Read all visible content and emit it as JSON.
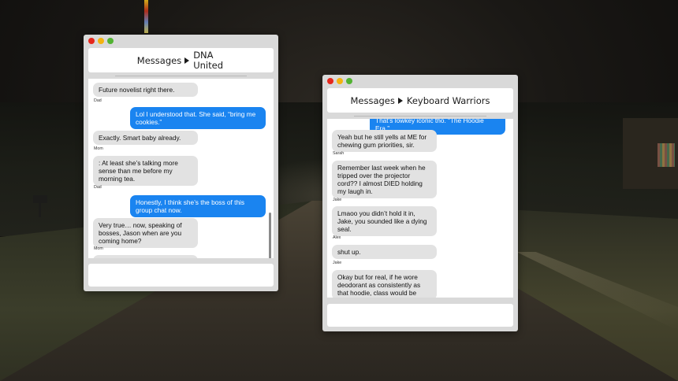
{
  "windows": [
    {
      "app_title": "Messages",
      "chat_title": "DNA United",
      "messages": [
        {
          "direction": "in",
          "text": "Future novelist right there."
        },
        {
          "sender": "Dad"
        },
        {
          "direction": "out",
          "text": "Lol I understood that. She said, “bring me cookies.”"
        },
        {
          "direction": "in",
          "text": "Exactly. Smart baby already."
        },
        {
          "sender": "Mom"
        },
        {
          "direction": "in",
          "text": ": At least she’s talking more sense than me before my morning tea."
        },
        {
          "sender": "Dad"
        },
        {
          "direction": "out",
          "text": "Honestly, I think she’s the boss of this group chat now."
        },
        {
          "direction": "in",
          "text": "Very true… now, speaking of bosses, Jason when are you coming home?"
        },
        {
          "sender": "Mom"
        }
      ]
    },
    {
      "app_title": "Messages",
      "chat_title": "Keyboard Warriors",
      "messages": [
        {
          "direction": "out",
          "text": "That’s lowkey iconic tho. “The Hoodie Era.”"
        },
        {
          "direction": "in",
          "text": "Yeah but he still yells at ME for chewing gum  priorities, sir."
        },
        {
          "sender": "Sarah"
        },
        {
          "direction": "in",
          "text": "Remember last week when he tripped over the projector cord?? I almost DIED holding my laugh in."
        },
        {
          "sender": "Jake"
        },
        {
          "direction": "in",
          "text": "Lmaoo you didn’t hold it in, Jake, you sounded like a dying seal."
        },
        {
          "sender": "Alex"
        },
        {
          "direction": "in",
          "text": "shut up."
        },
        {
          "sender": "Jake"
        },
        {
          "direction": "in",
          "text": "Okay but for real, if he wore deodorant as consistently as that hoodie, class would be"
        }
      ]
    }
  ],
  "colors": {
    "outgoing_bubble": "#1a84f0",
    "incoming_bubble": "#e2e2e2",
    "close": "#e6271c",
    "minimize": "#f3b30f",
    "maximize": "#52b332"
  }
}
